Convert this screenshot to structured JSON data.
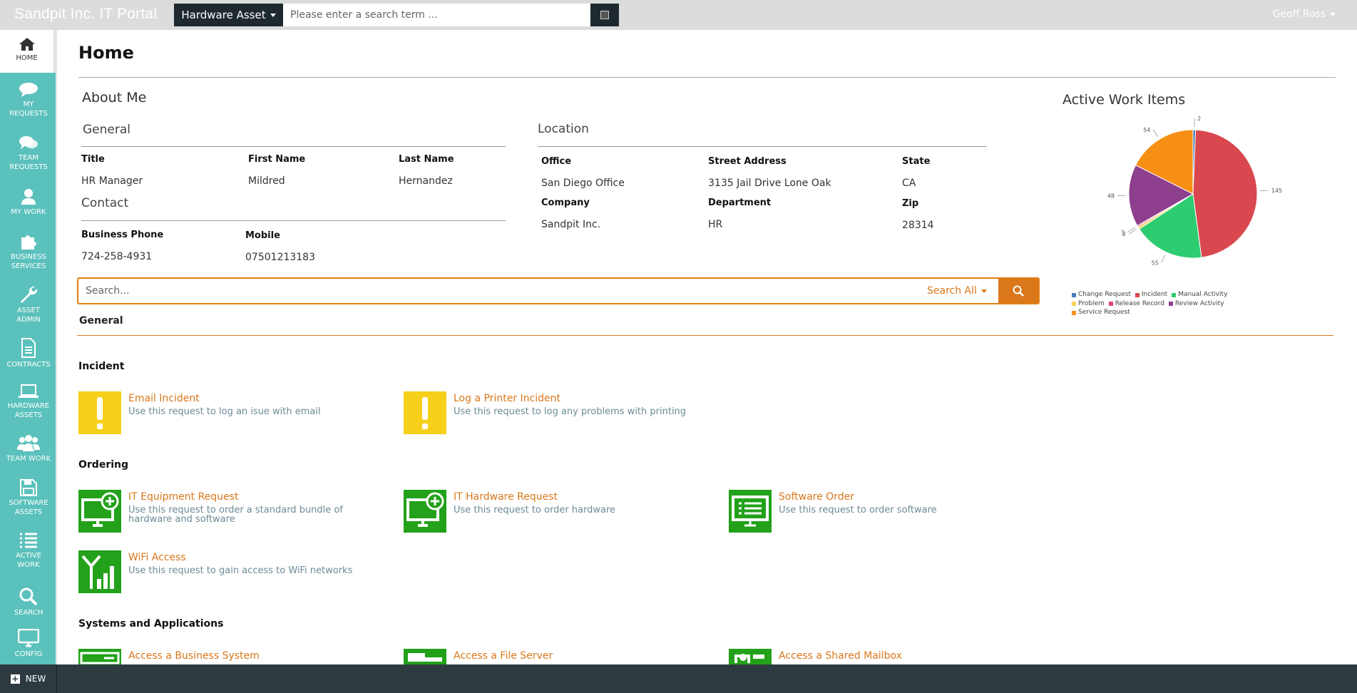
{
  "header": {
    "brand": "Sandpit Inc. IT Portal",
    "scope_label": "Hardware Asset",
    "search_placeholder": "Please enter a search term ...",
    "user_name": "Geoff Ross"
  },
  "sidebar": {
    "items": [
      {
        "label": "HOME",
        "icon": "home-icon"
      },
      {
        "label": "MY REQUESTS",
        "icon": "chat-icon"
      },
      {
        "label": "TEAM REQUESTS",
        "icon": "chat-multi-icon"
      },
      {
        "label": "MY WORK",
        "icon": "user-icon"
      },
      {
        "label": "BUSINESS SERVICES",
        "icon": "puzzle-icon"
      },
      {
        "label": "ASSET ADMIN",
        "icon": "wrench-icon"
      },
      {
        "label": "CONTRACTS",
        "icon": "document-icon"
      },
      {
        "label": "HARDWARE ASSETS",
        "icon": "laptop-icon"
      },
      {
        "label": "TEAM WORK",
        "icon": "users-icon"
      },
      {
        "label": "SOFTWARE ASSETS",
        "icon": "save-icon"
      },
      {
        "label": "ACTIVE WORK",
        "icon": "list-icon"
      },
      {
        "label": "SEARCH",
        "icon": "search-icon"
      },
      {
        "label": "CONFIG",
        "icon": "monitor-icon"
      }
    ]
  },
  "footer": {
    "new_label": "NEW"
  },
  "page": {
    "title": "Home"
  },
  "about": {
    "heading": "About Me",
    "general": {
      "heading": "General",
      "title_label": "Title",
      "title_value": "HR Manager",
      "first_label": "First Name",
      "first_value": "Mildred",
      "last_label": "Last Name",
      "last_value": "Hernandez"
    },
    "contact": {
      "heading": "Contact",
      "phone_label": "Business Phone",
      "phone_value": "724-258-4931",
      "mobile_label": "Mobile",
      "mobile_value": "07501213183"
    },
    "location": {
      "heading": "Location",
      "office_label": "Office",
      "office_value": "San Diego Office",
      "street_label": "Street Address",
      "street_value": "3135 Jail Drive Lone Oak",
      "state_label": "State",
      "state_value": "CA",
      "company_label": "Company",
      "company_value": "Sandpit Inc.",
      "dept_label": "Department",
      "dept_value": "HR",
      "zip_label": "Zip",
      "zip_value": "28314"
    }
  },
  "catalog_search": {
    "placeholder": "Search...",
    "scope": "Search All"
  },
  "catalog": {
    "general_heading": "General",
    "incident_heading": "Incident",
    "ordering_heading": "Ordering",
    "systems_heading": "Systems and Applications",
    "items": {
      "email_incident": {
        "title": "Email Incident",
        "desc": "Use this request to log an isue with email"
      },
      "printer_incident": {
        "title": "Log a Printer Incident",
        "desc": "Use this request to log any problems with printing"
      },
      "it_equipment": {
        "title": "IT Equipment Request",
        "desc": "Use this request to order a standard bundle of hardware and software"
      },
      "it_hardware": {
        "title": "IT Hardware Request",
        "desc": "Use this request to order hardware"
      },
      "software_order": {
        "title": "Software Order",
        "desc": "Use this request to order software"
      },
      "wifi": {
        "title": "WiFi Access",
        "desc": "Use this request to gain access to WiFi networks"
      },
      "business_system": {
        "title": "Access a Business System"
      },
      "file_server": {
        "title": "Access a File Server"
      },
      "shared_mailbox": {
        "title": "Access a Shared Mailbox"
      }
    }
  },
  "chart_title": "Active Work Items",
  "chart_data": {
    "type": "pie",
    "title": "Active Work Items",
    "series": [
      {
        "name": "Change Request",
        "value": 2,
        "color": "#4a7fbd"
      },
      {
        "name": "Incident",
        "value": 145,
        "color": "#d9484f"
      },
      {
        "name": "Manual Activity",
        "value": 55,
        "color": "#2ecc71"
      },
      {
        "name": "Problem",
        "value": 2,
        "color": "#f4d35e"
      },
      {
        "name": "Release Record",
        "value": 1,
        "color": "#e0457b"
      },
      {
        "name": "Review Activity",
        "value": 48,
        "color": "#8e3f8e"
      },
      {
        "name": "Service Request",
        "value": 54,
        "color": "#f78f14"
      }
    ],
    "legend_position": "bottom"
  }
}
